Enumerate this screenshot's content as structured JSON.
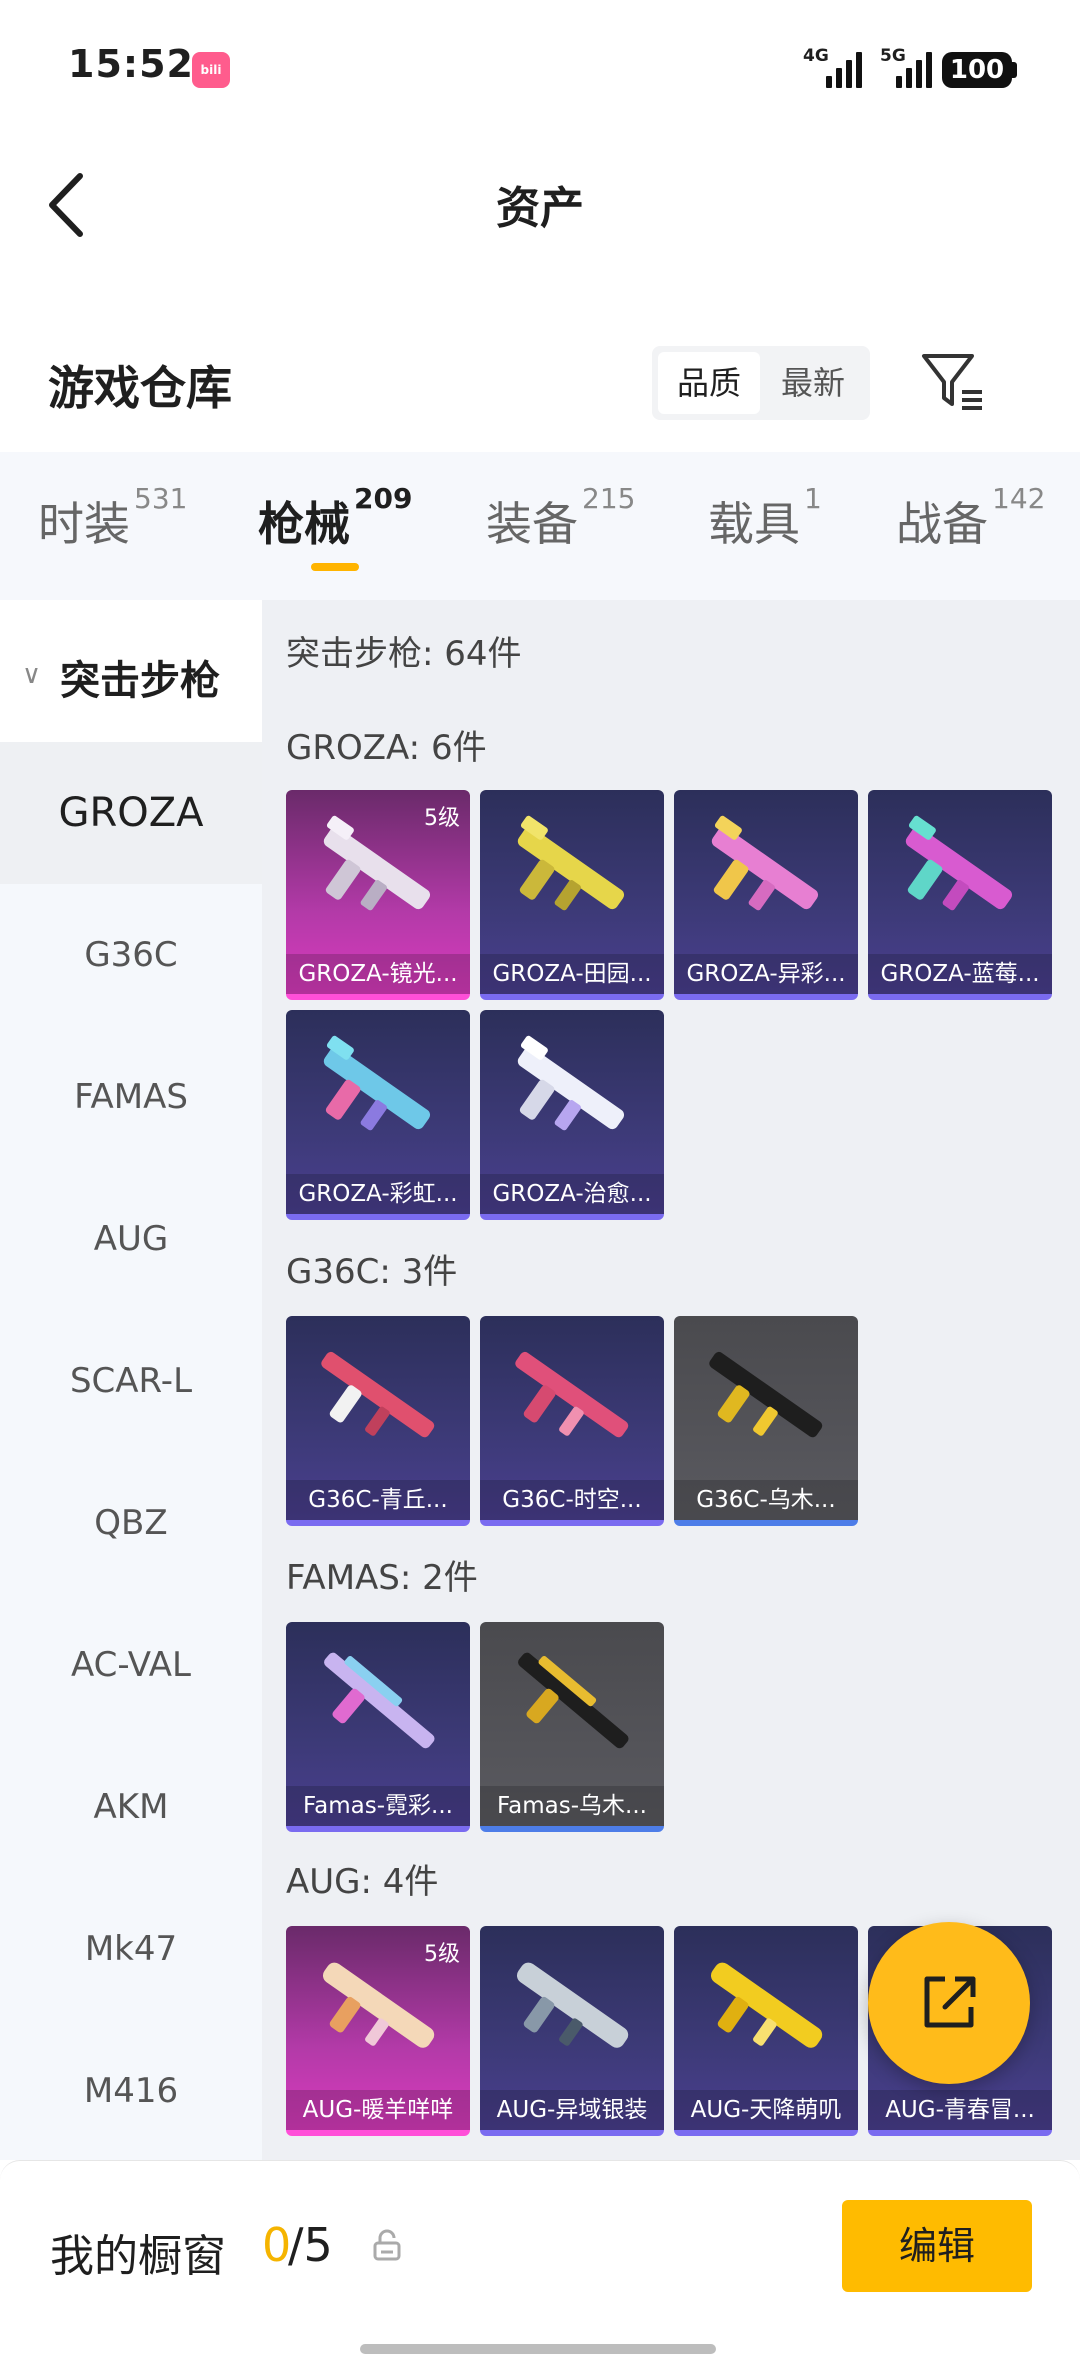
{
  "status_bar": {
    "time": "15:52",
    "network1": "4G",
    "network2": "5G",
    "battery": "100"
  },
  "header": {
    "title": "资产"
  },
  "section": {
    "title": "游戏仓库",
    "sort_options": [
      "品质",
      "最新"
    ],
    "sort_selected": "品质"
  },
  "tabs": [
    {
      "label": "时装",
      "count": "531"
    },
    {
      "label": "枪械",
      "count": "209",
      "active": true
    },
    {
      "label": "装备",
      "count": "215"
    },
    {
      "label": "载具",
      "count": "1"
    },
    {
      "label": "战备",
      "count": "142"
    }
  ],
  "sidebar": {
    "category": "突击步枪",
    "items": [
      "GROZA",
      "G36C",
      "FAMAS",
      "AUG",
      "SCAR-L",
      "QBZ",
      "AC-VAL",
      "AKM",
      "Mk47",
      "M416"
    ],
    "selected": "GROZA"
  },
  "content": {
    "summary": "突击步枪: 64件",
    "groups": [
      {
        "title": "GROZA: 6件",
        "items": [
          {
            "name": "GROZA-镜光...",
            "rarity": "pink",
            "level": "5级"
          },
          {
            "name": "GROZA-田园...",
            "rarity": "purple"
          },
          {
            "name": "GROZA-异彩...",
            "rarity": "purple"
          },
          {
            "name": "GROZA-蓝莓...",
            "rarity": "purple"
          },
          {
            "name": "GROZA-彩虹...",
            "rarity": "purple"
          },
          {
            "name": "GROZA-治愈...",
            "rarity": "purple"
          }
        ]
      },
      {
        "title": "G36C: 3件",
        "items": [
          {
            "name": "G36C-青丘...",
            "rarity": "purple"
          },
          {
            "name": "G36C-时空...",
            "rarity": "purple"
          },
          {
            "name": "G36C-乌木...",
            "rarity": "gray"
          }
        ]
      },
      {
        "title": "FAMAS: 2件",
        "items": [
          {
            "name": "Famas-霓彩...",
            "rarity": "purple"
          },
          {
            "name": "Famas-乌木...",
            "rarity": "gray"
          }
        ]
      },
      {
        "title": "AUG: 4件",
        "items": [
          {
            "name": "AUG-暖羊咩咩",
            "rarity": "pink",
            "level": "5级"
          },
          {
            "name": "AUG-异域银装",
            "rarity": "purple"
          },
          {
            "name": "AUG-天降萌叽",
            "rarity": "purple"
          },
          {
            "name": "AUG-青春冒...",
            "rarity": "purple"
          }
        ]
      }
    ]
  },
  "bottom_bar": {
    "label": "我的橱窗",
    "count_current": "0",
    "count_total": "/5",
    "edit_label": "编辑"
  },
  "colors": {
    "accent": "#ffbb00",
    "pink_rarity": "#d93bbd",
    "purple_rarity": "#3d3a78",
    "gray_rarity": "#5a5a60"
  }
}
